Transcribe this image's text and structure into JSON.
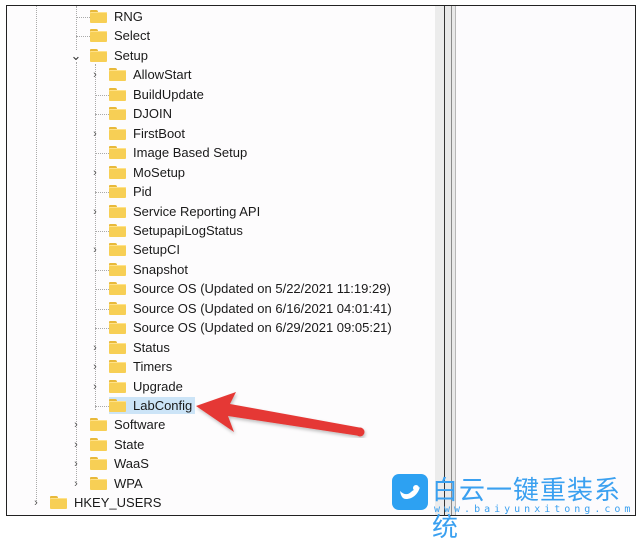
{
  "app": "Registry Editor",
  "tree": {
    "nodes": [
      {
        "label": "RNG",
        "expander": "none"
      },
      {
        "label": "Select",
        "expander": "none"
      },
      {
        "label": "Setup",
        "expander": "expanded"
      },
      {
        "label": "AllowStart",
        "expander": "collapsed"
      },
      {
        "label": "BuildUpdate",
        "expander": "none"
      },
      {
        "label": "DJOIN",
        "expander": "none"
      },
      {
        "label": "FirstBoot",
        "expander": "collapsed"
      },
      {
        "label": "Image Based Setup",
        "expander": "none"
      },
      {
        "label": "MoSetup",
        "expander": "collapsed"
      },
      {
        "label": "Pid",
        "expander": "none"
      },
      {
        "label": "Service Reporting API",
        "expander": "collapsed"
      },
      {
        "label": "SetupapiLogStatus",
        "expander": "none"
      },
      {
        "label": "SetupCI",
        "expander": "collapsed"
      },
      {
        "label": "Snapshot",
        "expander": "none"
      },
      {
        "label": "Source OS (Updated on 5/22/2021 11:19:29)",
        "expander": "none"
      },
      {
        "label": "Source OS (Updated on 6/16/2021 04:01:41)",
        "expander": "none"
      },
      {
        "label": "Source OS (Updated on 6/29/2021 09:05:21)",
        "expander": "none"
      },
      {
        "label": "Status",
        "expander": "collapsed"
      },
      {
        "label": "Timers",
        "expander": "collapsed"
      },
      {
        "label": "Upgrade",
        "expander": "collapsed"
      },
      {
        "label": "LabConfig",
        "expander": "none",
        "selected": true
      },
      {
        "label": "Software",
        "expander": "collapsed"
      },
      {
        "label": "State",
        "expander": "collapsed"
      },
      {
        "label": "WaaS",
        "expander": "collapsed"
      },
      {
        "label": "WPA",
        "expander": "collapsed"
      },
      {
        "label": "HKEY_USERS",
        "expander": "collapsed"
      }
    ],
    "expander_glyphs": {
      "collapsed": "›",
      "expanded": "⌄"
    }
  },
  "annotation": {
    "arrow_color": "#e53935",
    "points_to": "LabConfig"
  },
  "watermark": {
    "logo_icon": "bird-icon",
    "text": "白云一键重装系统",
    "url": "www.baiyunxitong.com",
    "color": "#3aa0f0"
  },
  "colors": {
    "selection": "#cce4f7",
    "folder": "#f7cf55"
  }
}
